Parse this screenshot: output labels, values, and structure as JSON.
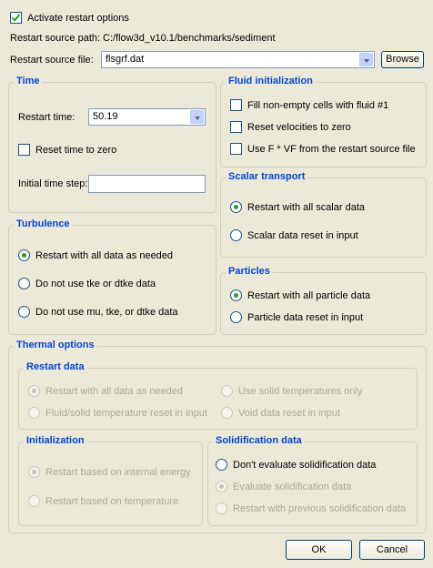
{
  "activate": {
    "label": "Activate restart options",
    "checked": true
  },
  "source_path": {
    "label": "Restart source path:",
    "value": "C:/flow3d_v10.1/benchmarks/sediment"
  },
  "source_file": {
    "label": "Restart source file:",
    "value": "flsgrf.dat",
    "browse_label": "Browse"
  },
  "time": {
    "title": "Time",
    "restart_time_label": "Restart time:",
    "restart_time_value": "50.19",
    "reset_time_label": "Reset time to zero",
    "initial_step_label": "Initial time step:",
    "initial_step_value": ""
  },
  "fluid_init": {
    "title": "Fluid initialization",
    "fill_label": "Fill non-empty cells with fluid #1",
    "reset_vel_label": "Reset velocities to zero",
    "use_f_label": "Use F * VF from the restart source file"
  },
  "scalar": {
    "title": "Scalar transport",
    "opt1": "Restart with all scalar data",
    "opt2": "Scalar data reset in input"
  },
  "turbulence": {
    "title": "Turbulence",
    "opt1": "Restart with all data as needed",
    "opt2": "Do not use tke or dtke data",
    "opt3": "Do not use mu, tke, or dtke data"
  },
  "particles": {
    "title": "Particles",
    "opt1": "Restart with all particle data",
    "opt2": "Particle data reset in input"
  },
  "thermal": {
    "title": "Thermal options",
    "restart_data": {
      "title": "Restart data",
      "opt1": "Restart with all data as needed",
      "opt2": "Fluid/solid temperature reset in input",
      "opt3": "Use solid temperatures only",
      "opt4": "Void data reset in input"
    },
    "initialization": {
      "title": "Initialization",
      "opt1": "Restart based on internal energy",
      "opt2": "Restart based on temperature"
    },
    "solidification": {
      "title": "Solidification data",
      "opt1": "Don't evaluate solidification data",
      "opt2": "Evaluate solidification data",
      "opt3": "Restart with previous solidification data"
    }
  },
  "buttons": {
    "ok": "OK",
    "cancel": "Cancel"
  },
  "colors": {
    "group_title": "#0046d5",
    "background": "#ece9d8",
    "check_green": "#21a121"
  }
}
